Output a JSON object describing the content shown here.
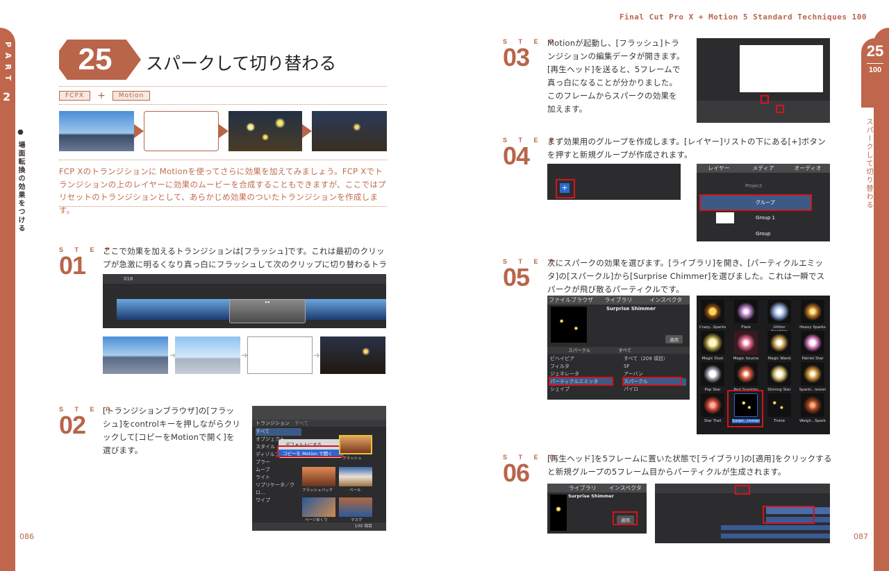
{
  "running_head": "Final Cut Pro X + Motion 5 Standard Techniques 100",
  "left_tab": {
    "part": "P A R T",
    "part_num": "2",
    "section": "● 場面転換の効果をつける"
  },
  "right_tab": {
    "chapter": "25",
    "total": "100",
    "label": "スパークして切り替わる"
  },
  "page_left": "086",
  "page_right": "087",
  "header": {
    "number": "25",
    "title": "スパークして切り替わる",
    "tag1": "FCPX",
    "plus": "+",
    "tag2": "Motion"
  },
  "intro": "FCP Xのトランジションに Motionを使ってさらに効果を加えてみましょう。FCP Xでトランジションの上のレイヤーに効果のムービーを合成することもできますが、ここではプリセットのトランジションとして、あらかじめ効果のついたトランジションを作成します。",
  "steps": [
    {
      "label": "S T E P",
      "num": "01",
      "text": "ここで効果を加えるトランジションは[フラッシュ]です。これは最初のクリップが急激に明るくなり真っ白にフラッシュして次のクリップに切り替わるトランジションです。"
    },
    {
      "label": "S T E P",
      "num": "02",
      "text": "[トランジションブラウザ]の[フラッシュ]をcontrolキーを押しながらクリックして[コピーをMotionで開く]を選びます。"
    },
    {
      "label": "S T E P",
      "num": "03",
      "text": "Motionが起動し、[フラッシュ]トランジションの編集データが開きます。[再生ヘッド]を送ると、5フレームで真っ白になることが分かりました。このフレームからスパークの効果を加えます。"
    },
    {
      "label": "S T E P",
      "num": "04",
      "text": "まず効果用のグループを作成します。[レイヤー]リストの下にある[+]ボタンを押すと新規グループが作成されます。"
    },
    {
      "label": "S T E P",
      "num": "05",
      "text": "次にスパークの効果を選びます。[ライブラリ]を開き、[パーティクルエミッタ]の[スパークル]から[Surprise Chimmer]を選びました。これは一瞬でスパークが飛び散るパーティクルです。"
    },
    {
      "label": "S T E P",
      "num": "06",
      "text": "[再生ヘッド]を5フレームに置いた状態で[ライブラリ]の[適用]をクリックすると新規グループの5フレーム目からパーティクルが生成されます。"
    }
  ],
  "s01_ui": {
    "timecode": "018",
    "clip_marker": "▸◂"
  },
  "s02_ui": {
    "header": "トランジション",
    "header2": "すべて",
    "list": [
      "すべて",
      "オブジェクト",
      "スタイル",
      "ディゾルブ",
      "ブラー",
      "ムーブ",
      "ライト",
      "リプリケータ／クロ…",
      "ワイプ"
    ],
    "menu1": "デフォルトにする",
    "menu2": "コピーを Motion で開く",
    "thumbs": [
      "フラッシュ",
      "フラッシュバック",
      "ベール",
      "ページめくり",
      "マスク"
    ],
    "count": "109 項目"
  },
  "s04_ui": {
    "tabs": [
      "レイヤー",
      "メディア",
      "オーディオ"
    ],
    "rows": [
      "Project",
      "グループ",
      "Group 1",
      "Group"
    ]
  },
  "s05_ui": {
    "tabs": [
      "ファイルブラウザ",
      "ライブラリ",
      "インスペクタ"
    ],
    "preview_name": "Surprise Shimmer",
    "apply": "適用",
    "crumb1": "スパークル",
    "crumb2": "すべて",
    "cats": [
      "ビヘイビア",
      "フィルタ",
      "ジェネレータ",
      "パーティクルエミッタ",
      "シェイプ"
    ],
    "subs": [
      "すべて（209 項目）",
      "SF",
      "アーバン",
      "スパークル",
      "パイロ"
    ],
    "items": [
      "Crazy...Sparks",
      "Flare",
      "Glitter Sparkles",
      "Heavy Sparks",
      "Magic Dust",
      "Magic Source",
      "Magic Wand",
      "Patriot Star",
      "Pop Star",
      "Red Sparkler",
      "Shining Star",
      "Sparkl...losion",
      "Star Trail",
      "Surpri...immer",
      "Tinkle",
      "Weigh...Spark"
    ]
  },
  "s06_ui": {
    "tabs": [
      "ライブラリ",
      "インスペクタ"
    ],
    "name": "Surprise Shimmer",
    "apply": "適用"
  },
  "colors": {
    "accent": "#b8654a",
    "highlight": "#d4141e"
  }
}
